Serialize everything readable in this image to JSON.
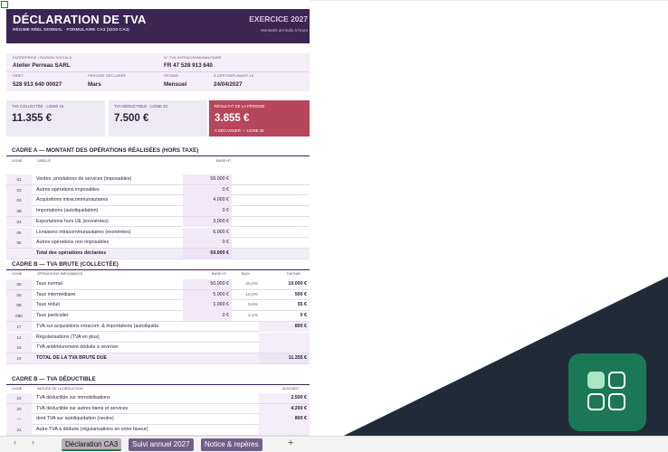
{
  "header": {
    "title": "DÉCLARATION DE TVA",
    "subtitle": "RÉGIME RÉEL NORMAL · FORMULAIRE CA3 (3310-CA3)",
    "exercise": "EXERCICE 2027",
    "rounding": "Montants arrondis à l'euro"
  },
  "info": {
    "company_label": "ENTREPRISE / RAISON SOCIALE",
    "company": "Atelier Perreau SARL",
    "vat_label": "N° TVA INTRACOMMUNAUTAIRE",
    "vat": "FR 47 528 913 640",
    "siret_label": "SIRET",
    "siret": "528 913 640 00027",
    "period_label": "PÉRIODE DÉCLARÉE",
    "period": "Mars",
    "regime_label": "RÉGIME",
    "regime": "Mensuel",
    "deadline_label": "À DÉPOSER AVANT LE",
    "deadline": "24/04/2027"
  },
  "cards": {
    "collected_label": "TVA COLLECTÉE · LIGNE 16",
    "collected": "11.355 €",
    "deductible_label": "TVA DÉDUCTIBLE · LIGNE 23",
    "deductible": "7.500 €",
    "result_label": "RÉSULTAT DE LA PÉRIODE",
    "result": "3.855 €",
    "result_sub": "À DÉCAISSER — LIGNE 28"
  },
  "cadre_a": {
    "title": "CADRE A — MONTANT DES OPÉRATIONS RÉALISÉES (HORS TAXE)",
    "headers": {
      "code": "LIGNE",
      "label": "LIBELLÉ",
      "base": "BASE HT"
    },
    "rows": [
      {
        "code": "01",
        "label": "Ventes, prestations de services (imposables)",
        "base": "56.000 €"
      },
      {
        "code": "02",
        "label": "Autres opérations imposables",
        "base": "0 €"
      },
      {
        "code": "03",
        "label": "Acquisitions intracommunautaires",
        "base": "4.000 €"
      },
      {
        "code": "3B",
        "label": "Importations (autoliquidation)",
        "base": "0 €"
      },
      {
        "code": "04",
        "label": "Exportations hors UE (exonérées)",
        "base": "3.000 €"
      },
      {
        "code": "06",
        "label": "Livraisons intracommunautaires (exonérées)",
        "base": "6.000 €"
      },
      {
        "code": "05",
        "label": "Autres opérations non imposables",
        "base": "0 €"
      }
    ],
    "total": {
      "label": "Total des opérations déclarées",
      "base": "69.000 €"
    }
  },
  "cadre_b1": {
    "title": "CADRE B — TVA BRUTE (COLLECTÉE)",
    "headers": {
      "code": "LIGNE",
      "label": "OPÉRATIONS IMPOSABLES",
      "base": "BASE HT",
      "rate": "TAUX",
      "vat": "TVA DUE"
    },
    "rows": [
      {
        "code": "08",
        "label": "Taux normal",
        "base": "50.000 €",
        "rate": "20,0%",
        "vat": "10.000 €"
      },
      {
        "code": "09",
        "label": "Taux intermédiaire",
        "base": "5.000 €",
        "rate": "10,0%",
        "vat": "500 €"
      },
      {
        "code": "9B",
        "label": "Taux réduit",
        "base": "1.000 €",
        "rate": "5,5%",
        "vat": "55 €"
      },
      {
        "code": "08b",
        "label": "Taux particulier",
        "base": "0 €",
        "rate": "2,1%",
        "vat": "0 €"
      },
      {
        "code": "17",
        "label": "TVA sur acquisitions intracom. & importations (autoliquida",
        "base": "",
        "rate": "",
        "vat": "800 €"
      },
      {
        "code": "14",
        "label": "Régularisations (TVA en plus)",
        "base": "",
        "rate": "",
        "vat": ""
      },
      {
        "code": "15",
        "label": "TVA antérieurement déduite à reverser",
        "base": "",
        "rate": "",
        "vat": ""
      }
    ],
    "total": {
      "code": "16",
      "label": "TOTAL DE LA TVA BRUTE DUE",
      "vat": "11.355 €"
    }
  },
  "cadre_b2": {
    "title": "CADRE B — TVA DÉDUCTIBLE",
    "headers": {
      "code": "LIGNE",
      "label": "NATURE DE LA DÉDUCTION",
      "amount": "MONTANT"
    },
    "rows": [
      {
        "code": "19",
        "label": "TVA déductible sur immobilisations",
        "amount": "2.500 €"
      },
      {
        "code": "20",
        "label": "TVA déductible sur autres biens et services",
        "amount": "4.200 €"
      },
      {
        "code": "—",
        "label": "dont TVA sur autoliquidation (neutre)",
        "amount": "800 €"
      },
      {
        "code": "21",
        "label": "Autre TVA à déduire (régularisations en votre faveur)",
        "amount": ""
      }
    ]
  },
  "tabs": {
    "prev": "‹",
    "next": "›",
    "items": [
      "Déclaration CA3",
      "Suivi annuel 2027",
      "Notice & repères"
    ],
    "add": "+"
  },
  "colors": {
    "band": "#3b2551",
    "result": "#b7465a",
    "app": "#1a7856",
    "accent": "#a8e6c5"
  },
  "icons": {
    "app": "grid-app-icon"
  }
}
